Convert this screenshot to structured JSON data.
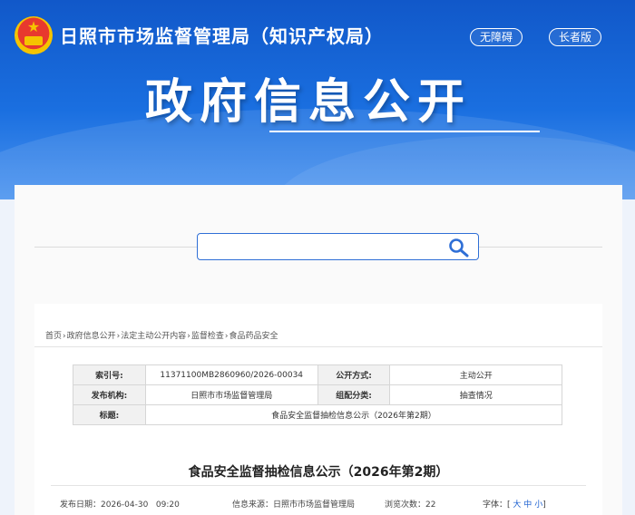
{
  "header": {
    "site_name": "日照市市场监督管理局（知识产权局）",
    "accessibility_label": "无障碍",
    "elder_label": "长者版",
    "big_title": "政府信息公开",
    "emblem_star": "★"
  },
  "search": {
    "value": "",
    "placeholder": ""
  },
  "breadcrumb": {
    "items": [
      "首页",
      "政府信息公开",
      "法定主动公开内容",
      "监督检查",
      "食品药品安全"
    ],
    "separator": "›"
  },
  "meta": {
    "index_label": "索引号:",
    "index_value": "11371100MB2860960/2026-00034",
    "public_mode_label": "公开方式:",
    "public_mode_value": "主动公开",
    "issuer_label": "发布机构:",
    "issuer_value": "日照市市场监督管理局",
    "category_label": "组配分类:",
    "category_value": "抽查情况",
    "title_label": "标题:",
    "title_value": "食品安全监督抽检信息公示（2026年第2期）"
  },
  "article": {
    "title": "食品安全监督抽检信息公示（2026年第2期）",
    "date_label": "发布日期：",
    "date_value": "2026-04-30   09:20",
    "source_label": "信息来源：",
    "source_value": "日照市市场监督管理局",
    "views_label": "浏览次数：",
    "views_value": "22",
    "font_label": "字体：",
    "font_open": "[",
    "font_large": "大",
    "font_medium": "中",
    "font_small": "小",
    "font_close": "]"
  },
  "colors": {
    "banner_top": "#1158c9",
    "banner_bottom": "#4a93ef",
    "accent": "#2f6fd6"
  }
}
